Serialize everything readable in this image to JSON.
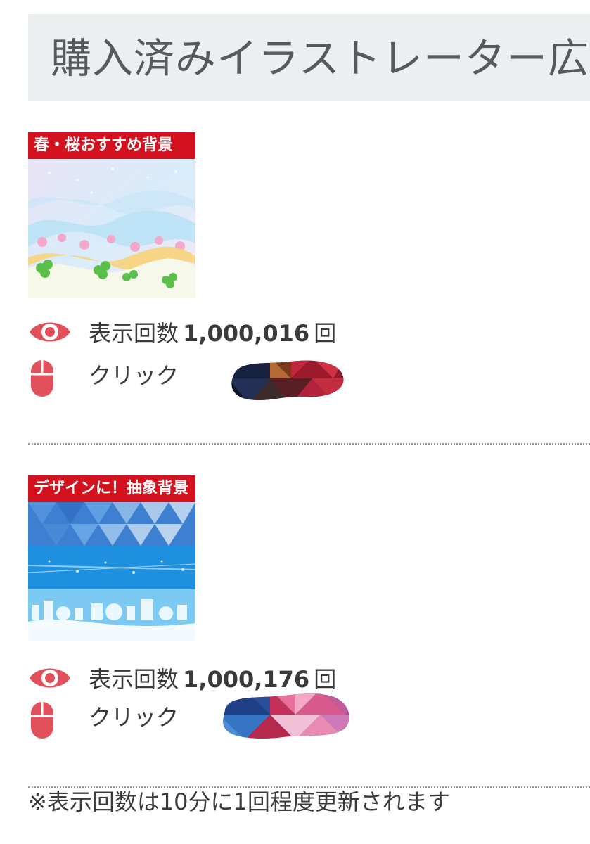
{
  "header": {
    "title": "購入済みイラストレーター広"
  },
  "ads": [
    {
      "banner_label": "春・桜おすすめ背景",
      "views_label": "表示回数",
      "views_value": "1,000,016",
      "views_unit": "回",
      "click_label": "クリック"
    },
    {
      "banner_label": "デザインに！抽象背景",
      "views_label": "表示回数",
      "views_value": "1,000,176",
      "views_unit": "回",
      "click_label": "クリック"
    }
  ],
  "footer": {
    "note": "※表示回数は10分に1回程度更新されます"
  },
  "colors": {
    "accent": "#d4111f",
    "icon": "#e2505c",
    "header_bg": "#eceff0"
  },
  "icons": [
    "eye-icon",
    "mouse-icon"
  ]
}
